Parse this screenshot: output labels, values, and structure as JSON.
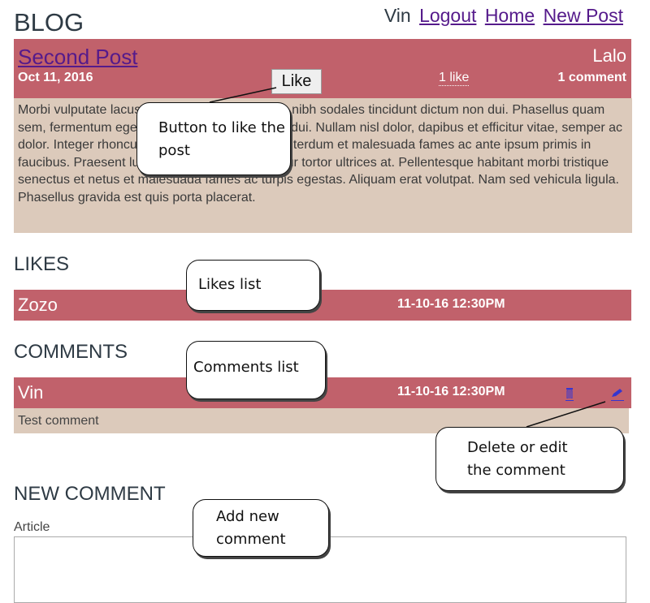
{
  "header": {
    "title": "BLOG",
    "nav": {
      "user": "Vin",
      "logout": "Logout",
      "home": "Home",
      "new_post": "New Post"
    }
  },
  "post": {
    "title": "Second Post",
    "author": "Lalo",
    "date": "Oct 11, 2016",
    "like_button": "Like",
    "like_count": "1 like",
    "comment_count": "1 comment",
    "body": "Morbi vulputate lacus sed leo porttitor, et nisl in nibh sodales tincidunt dictum non dui. Phasellus quam sem, fermentum eget tellus a, luctus commodo dui. Nullam nisl dolor, dapibus et efficitur vitae, semper ac dolor. Integer rhoncus interdum pellentesque. Interdum et malesuada fames ac ante ipsum primis in faucibus. Praesent luctus odio arcu, eget efficitur tortor ultrices at. Pellentesque habitant morbi tristique senectus et netus et malesuada fames ac turpis egestas. Aliquam erat volutpat. Nam sed vehicula ligula. Phasellus gravida est quis porta placerat."
  },
  "likes": {
    "title": "LIKES",
    "items": [
      {
        "name": "Zozo",
        "date": "11-10-16 12:30PM"
      }
    ]
  },
  "comments": {
    "title": "COMMENTS",
    "items": [
      {
        "name": "Vin",
        "date": "11-10-16 12:30PM",
        "text": "Test comment",
        "delete_icon": "trash-icon",
        "edit_icon": "pencil-icon"
      }
    ]
  },
  "new_comment": {
    "title": "NEW COMMENT",
    "label": "Article",
    "value": ""
  },
  "callouts": {
    "like_button": "Button to like the post",
    "likes_list": "Likes list",
    "comments_list": "Comments list",
    "delete_edit": "Delete or edit the comment",
    "add_comment": "Add new comment"
  },
  "colors": {
    "header_bar": "#c1616b",
    "body_bg": "#dccabb",
    "link": "#551a8b",
    "text": "#2e3a44"
  }
}
